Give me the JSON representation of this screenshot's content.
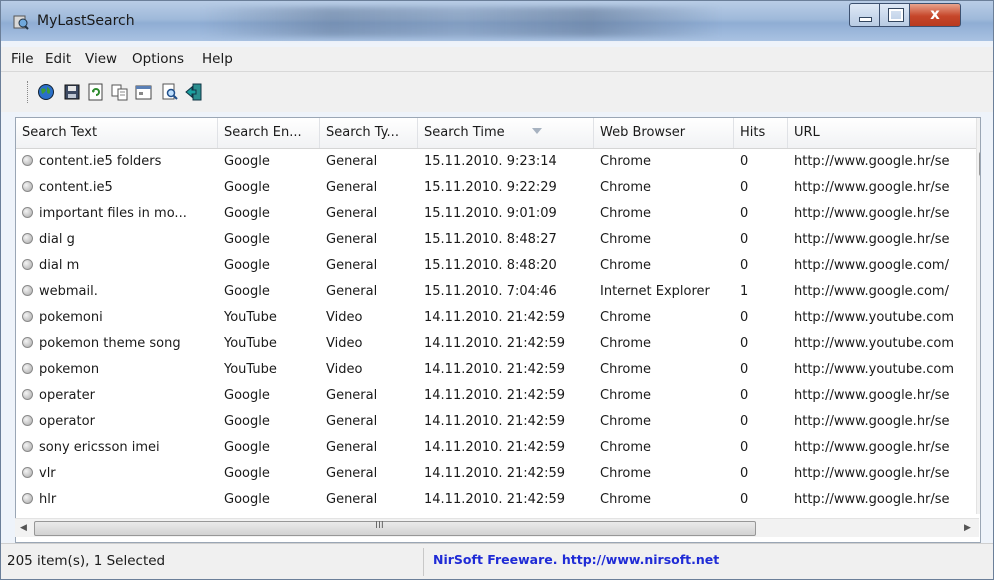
{
  "window": {
    "title": "MyLastSearch",
    "close_glyph": "x"
  },
  "menu": [
    "File",
    "Edit",
    "View",
    "Options",
    "Help"
  ],
  "toolbar_icons": [
    "globe-icon",
    "save-icon",
    "refresh-icon",
    "copy-icon",
    "properties-icon",
    "find-icon",
    "exit-icon"
  ],
  "columns": [
    "Search Text",
    "Search En...",
    "Search Ty...",
    "Search Time",
    "Web Browser",
    "Hits",
    "URL"
  ],
  "rows": [
    [
      "content.ie5 folders",
      "Google",
      "General",
      "15.11.2010. 9:23:14",
      "Chrome",
      "0",
      "http://www.google.hr/se"
    ],
    [
      "content.ie5",
      "Google",
      "General",
      "15.11.2010. 9:22:29",
      "Chrome",
      "0",
      "http://www.google.hr/se"
    ],
    [
      "important files in mo...",
      "Google",
      "General",
      "15.11.2010. 9:01:09",
      "Chrome",
      "0",
      "http://www.google.hr/se"
    ],
    [
      "dial g",
      "Google",
      "General",
      "15.11.2010. 8:48:27",
      "Chrome",
      "0",
      "http://www.google.hr/se"
    ],
    [
      "dial m",
      "Google",
      "General",
      "15.11.2010. 8:48:20",
      "Chrome",
      "0",
      "http://www.google.com/"
    ],
    [
      "webmail.",
      "Google",
      "General",
      "15.11.2010. 7:04:46",
      "Internet Explorer",
      "1",
      "http://www.google.com/"
    ],
    [
      "pokemoni",
      "YouTube",
      "Video",
      "14.11.2010. 21:42:59",
      "Chrome",
      "0",
      "http://www.youtube.com"
    ],
    [
      "pokemon theme song",
      "YouTube",
      "Video",
      "14.11.2010. 21:42:59",
      "Chrome",
      "0",
      "http://www.youtube.com"
    ],
    [
      "pokemon",
      "YouTube",
      "Video",
      "14.11.2010. 21:42:59",
      "Chrome",
      "0",
      "http://www.youtube.com"
    ],
    [
      "operater",
      "Google",
      "General",
      "14.11.2010. 21:42:59",
      "Chrome",
      "0",
      "http://www.google.hr/se"
    ],
    [
      "operator",
      "Google",
      "General",
      "14.11.2010. 21:42:59",
      "Chrome",
      "0",
      "http://www.google.hr/se"
    ],
    [
      "sony ericsson imei",
      "Google",
      "General",
      "14.11.2010. 21:42:59",
      "Chrome",
      "0",
      "http://www.google.hr/se"
    ],
    [
      "vlr",
      "Google",
      "General",
      "14.11.2010. 21:42:59",
      "Chrome",
      "0",
      "http://www.google.hr/se"
    ],
    [
      "hlr",
      "Google",
      "General",
      "14.11.2010. 21:42:59",
      "Chrome",
      "0",
      "http://www.google.hr/se"
    ]
  ],
  "scrollbar": {
    "grip": "III"
  },
  "status": {
    "count": "205 item(s), 1 Selected",
    "link": "NirSoft Freeware.  http://www.nirsoft.net"
  },
  "colors": {
    "link": "#1f2bd6",
    "close": "#c6462a"
  }
}
